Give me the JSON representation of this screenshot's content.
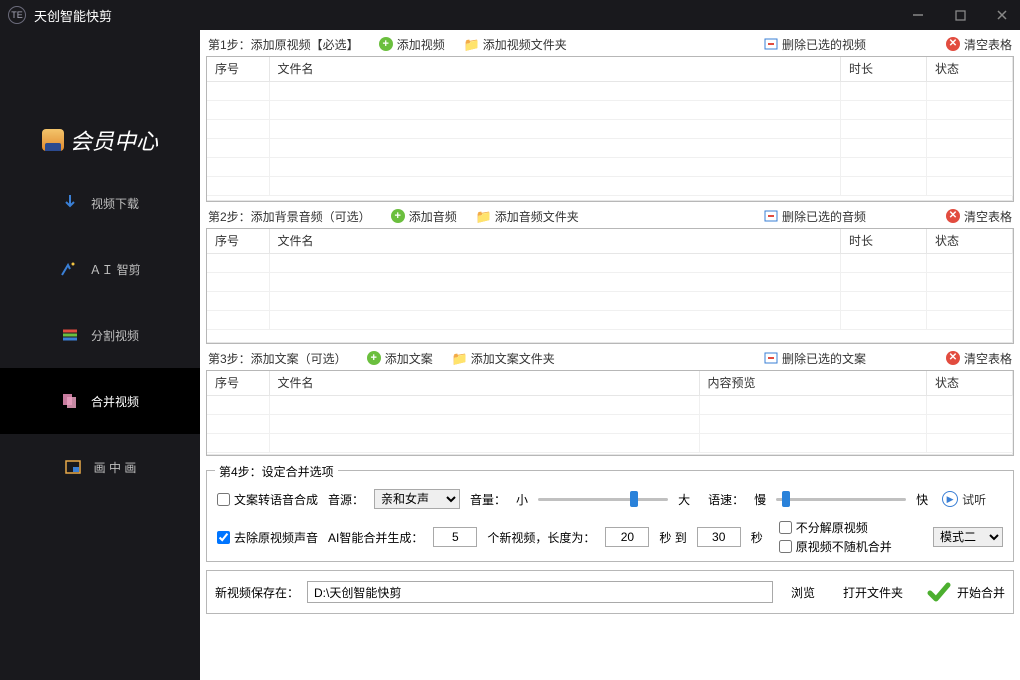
{
  "window": {
    "logo_text": "TE",
    "title": "天创智能快剪"
  },
  "sidebar": {
    "member_center": "会员中心",
    "items": [
      {
        "label": "视频下载"
      },
      {
        "label": "ＡＩ 智剪"
      },
      {
        "label": "分割视频"
      },
      {
        "label": "合并视频"
      },
      {
        "label": "画 中 画"
      }
    ]
  },
  "step1": {
    "label": "第1步：添加原视频【必选】",
    "add": "添加视频",
    "add_folder": "添加视频文件夹",
    "delete": "删除已选的视频",
    "clear": "清空表格",
    "cols": {
      "no": "序号",
      "name": "文件名",
      "duration": "时长",
      "status": "状态"
    }
  },
  "step2": {
    "label": "第2步：添加背景音频（可选）",
    "add": "添加音频",
    "add_folder": "添加音频文件夹",
    "delete": "删除已选的音频",
    "clear": "清空表格",
    "cols": {
      "no": "序号",
      "name": "文件名",
      "duration": "时长",
      "status": "状态"
    }
  },
  "step3": {
    "label": "第3步：添加文案（可选）",
    "add": "添加文案",
    "add_folder": "添加文案文件夹",
    "delete": "删除已选的文案",
    "clear": "清空表格",
    "cols": {
      "no": "序号",
      "name": "文件名",
      "preview": "内容预览",
      "status": "状态"
    }
  },
  "step4": {
    "label": "第4步：设定合并选项",
    "tts": "文案转语音合成",
    "voice_label": "音源：",
    "voice_options": [
      "亲和女声"
    ],
    "voice_selected": "亲和女声",
    "volume_label": "音量：",
    "vol_small": "小",
    "vol_big": "大",
    "speed_label": "语速：",
    "spd_slow": "慢",
    "spd_fast": "快",
    "preview": "试听",
    "remove_audio": "去除原视频声音",
    "ai_label": "AI智能合并生成：",
    "count": "5",
    "count_unit": "个新视频，长度为：",
    "len_from": "20",
    "sec_to": "秒 到",
    "len_to": "30",
    "sec": "秒",
    "no_split": "不分解原视频",
    "no_random": "原视频不随机合并",
    "mode_options": [
      "模式二"
    ],
    "mode_selected": "模式二"
  },
  "save": {
    "label": "新视频保存在：",
    "path": "D:\\天创智能快剪",
    "browse": "浏览",
    "open": "打开文件夹",
    "start": "开始合并"
  }
}
